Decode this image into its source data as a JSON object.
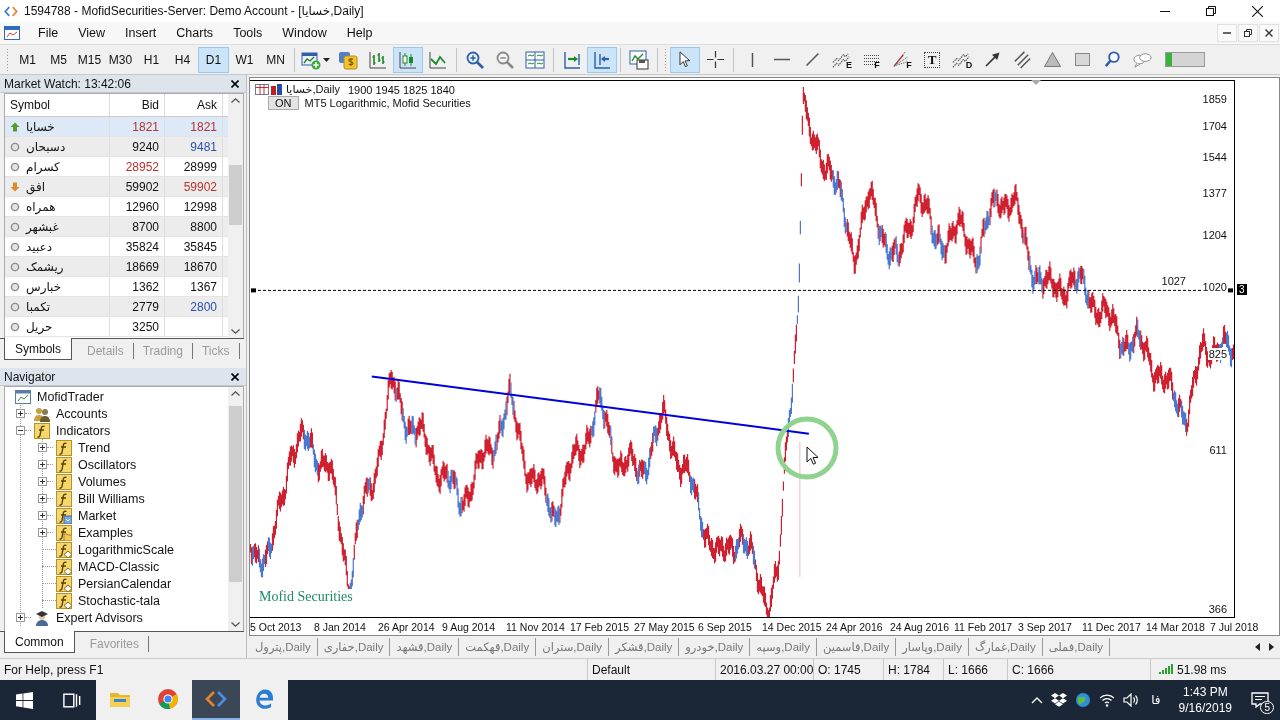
{
  "window": {
    "title": "1594788 - MofidSecurities-Server: Demo Account - [خسایا,Daily]"
  },
  "menu": [
    "File",
    "View",
    "Insert",
    "Charts",
    "Tools",
    "Window",
    "Help"
  ],
  "toolbar": {
    "timeframes": [
      {
        "label": "M1",
        "selected": false
      },
      {
        "label": "M5",
        "selected": false
      },
      {
        "label": "M15",
        "selected": false
      },
      {
        "label": "M30",
        "selected": false
      },
      {
        "label": "H1",
        "selected": false
      },
      {
        "label": "H4",
        "selected": false
      },
      {
        "label": "D1",
        "selected": true
      },
      {
        "label": "W1",
        "selected": false
      },
      {
        "label": "MN",
        "selected": false
      }
    ],
    "chart_tools": [
      {
        "kind": "new-chart",
        "selected": false
      },
      {
        "kind": "profiles",
        "selected": false
      },
      {
        "kind": "bar-chart",
        "selected": false
      },
      {
        "kind": "candles",
        "selected": true
      },
      {
        "kind": "line-chart",
        "selected": false
      },
      {
        "kind": "zoom-in",
        "selected": false
      },
      {
        "kind": "zoom-out",
        "selected": false
      },
      {
        "kind": "tile",
        "selected": false
      },
      {
        "kind": "autoscroll",
        "selected": false
      },
      {
        "kind": "chart-shift",
        "selected": true
      },
      {
        "kind": "templates",
        "selected": false
      }
    ],
    "drawing_tools": [
      {
        "kind": "cursor",
        "selected": true
      },
      {
        "kind": "crosshair",
        "selected": false
      },
      {
        "kind": "vertical-line",
        "selected": false
      },
      {
        "kind": "horizontal-line",
        "selected": false
      },
      {
        "kind": "trend-line",
        "selected": false
      },
      {
        "kind": "waves",
        "letter": "E",
        "selected": false
      },
      {
        "kind": "levels",
        "letter": "F",
        "selected": false
      },
      {
        "kind": "fan",
        "letter": "F",
        "selected": false
      },
      {
        "kind": "text",
        "letter": "T",
        "selected": false
      },
      {
        "kind": "waves",
        "letter": "D",
        "selected": false
      },
      {
        "kind": "arrow",
        "selected": false
      },
      {
        "kind": "channel",
        "selected": false
      },
      {
        "kind": "triangle",
        "selected": false
      },
      {
        "kind": "rectangle",
        "selected": false
      },
      {
        "kind": "search",
        "selected": false
      },
      {
        "kind": "chat",
        "selected": false
      }
    ],
    "meter": {
      "level": 0.15
    }
  },
  "market_watch": {
    "title": "Market Watch: 13:42:06",
    "columns": [
      "Symbol",
      "Bid",
      "Ask"
    ],
    "rows": [
      {
        "symbol": "خسایا",
        "kind": "up",
        "bid": {
          "text": "1821",
          "color": "#b8332b"
        },
        "ask": {
          "text": "1821",
          "color": "#b8332b"
        },
        "selected": true
      },
      {
        "symbol": "دسبحان",
        "kind": "flat",
        "bid": {
          "text": "9240",
          "color": "#111111"
        },
        "ask": {
          "text": "9481",
          "color": "#2a4fb0"
        },
        "selected": false
      },
      {
        "symbol": "کسرام",
        "kind": "flat",
        "bid": {
          "text": "28952",
          "color": "#b8332b"
        },
        "ask": {
          "text": "28999",
          "color": "#111111"
        },
        "selected": false
      },
      {
        "symbol": "افق",
        "kind": "down",
        "bid": {
          "text": "59902",
          "color": "#111111"
        },
        "ask": {
          "text": "59902",
          "color": "#b8332b"
        },
        "selected": false
      },
      {
        "symbol": "همراه",
        "kind": "flat",
        "bid": {
          "text": "12960",
          "color": "#111111"
        },
        "ask": {
          "text": "12998",
          "color": "#111111"
        },
        "selected": false
      },
      {
        "symbol": "غبشهر",
        "kind": "flat",
        "bid": {
          "text": "8700",
          "color": "#111111"
        },
        "ask": {
          "text": "8800",
          "color": "#111111"
        },
        "selected": false
      },
      {
        "symbol": "دعبید",
        "kind": "flat",
        "bid": {
          "text": "35824",
          "color": "#111111"
        },
        "ask": {
          "text": "35845",
          "color": "#111111"
        },
        "selected": false
      },
      {
        "symbol": "ریشمک",
        "kind": "flat",
        "bid": {
          "text": "18669",
          "color": "#111111"
        },
        "ask": {
          "text": "18670",
          "color": "#111111"
        },
        "selected": false
      },
      {
        "symbol": "خبارس",
        "kind": "flat",
        "bid": {
          "text": "1362",
          "color": "#111111"
        },
        "ask": {
          "text": "1367",
          "color": "#111111"
        },
        "selected": false
      },
      {
        "symbol": "تکمبا",
        "kind": "flat",
        "bid": {
          "text": "2779",
          "color": "#111111"
        },
        "ask": {
          "text": "2800",
          "color": "#2a4fb0"
        },
        "selected": false
      },
      {
        "symbol": "حریل",
        "kind": "flat",
        "bid": {
          "text": "3250",
          "color": "#111111"
        },
        "selected": false
      }
    ],
    "tabs": [
      {
        "label": "Symbols",
        "selected": true
      },
      {
        "label": "Details",
        "selected": false
      },
      {
        "label": "Trading",
        "selected": false
      },
      {
        "label": "Ticks",
        "selected": false
      }
    ]
  },
  "navigator": {
    "title": "Navigator",
    "tree": [
      {
        "label": "MofidTrader",
        "kind": "terminal",
        "children": [
          {
            "label": "Accounts",
            "kind": "accounts",
            "expanded": false
          },
          {
            "label": "Indicators",
            "kind": "function-folder",
            "expanded": true,
            "children": [
              {
                "label": "Trend",
                "kind": "function-folder",
                "expanded": false
              },
              {
                "label": "Oscillators",
                "kind": "function-folder",
                "expanded": false
              },
              {
                "label": "Volumes",
                "kind": "function-folder",
                "expanded": false
              },
              {
                "label": "Bill Williams",
                "kind": "function-folder",
                "expanded": false
              },
              {
                "label": "Market",
                "kind": "market-folder",
                "expanded": false
              },
              {
                "label": "Examples",
                "kind": "examples-folder",
                "expanded": false
              },
              {
                "label": "LogarithmicScale",
                "kind": "indicator"
              },
              {
                "label": "MACD-Classic",
                "kind": "indicator"
              },
              {
                "label": "PersianCalendar",
                "kind": "indicator"
              },
              {
                "label": "Stochastic-tala",
                "kind": "indicator"
              }
            ]
          },
          {
            "label": "Expert Advisors",
            "kind": "experts",
            "expanded": false
          }
        ]
      }
    ],
    "tabs": [
      {
        "label": "Common",
        "selected": true
      },
      {
        "label": "Favorites",
        "selected": false
      }
    ]
  },
  "chart": {
    "symbol": "خسایا,Daily",
    "prices": "1900 1945 1825 1840",
    "indicator_toggle": "ON",
    "indicator_label": "MT5 Logarithmic, Mofid Securities",
    "brand_label": "Mofid Securities",
    "price_labels": [
      "1859",
      "1704",
      "1544",
      "1377",
      "1204",
      "1020",
      "825",
      "611",
      "366"
    ],
    "date_labels": [
      "5 Oct 2013",
      "8 Jan 2014",
      "26 Apr 2014",
      "9 Aug 2014",
      "11 Nov 2014",
      "17 Feb 2015",
      "27 May 2015",
      "6 Sep 2015",
      "14 Dec 2015",
      "24 Apr 2016",
      "24 Aug 2016",
      "11 Feb 2017",
      "3 Sep 2017",
      "11 Dec 2017",
      "14 Mar 2018",
      "7 Jul 2018"
    ],
    "level_line": {
      "label": "1027",
      "tag": "3"
    }
  },
  "chart_tabs": [
    {
      "label": "پترول,Daily",
      "selected": false
    },
    {
      "label": "حفاری,Daily",
      "selected": false
    },
    {
      "label": "قشهد,Daily",
      "selected": false
    },
    {
      "label": "قهکمت,Daily",
      "selected": false
    },
    {
      "label": "ستران,Daily",
      "selected": false
    },
    {
      "label": "قشکر,Daily",
      "selected": false
    },
    {
      "label": "خودرو,Daily",
      "selected": false
    },
    {
      "label": "وسپه,Daily",
      "selected": false
    },
    {
      "label": "فاسمین,Daily",
      "selected": false
    },
    {
      "label": "وپاسار,Daily",
      "selected": false
    },
    {
      "label": "غمارگ,Daily",
      "selected": false
    },
    {
      "label": "فملی,Daily",
      "selected": false
    }
  ],
  "status_bar": {
    "help": "For Help, press F1",
    "profile": "Default",
    "time": "2016.03.27 00:00",
    "open": "O: 1745",
    "high": "H: 1784",
    "low": "L: 1666",
    "close": "C: 1666",
    "ping": "51.98 ms"
  },
  "taskbar": {
    "apps": [
      {
        "kind": "files",
        "selected": false
      },
      {
        "kind": "browser",
        "selected": false
      },
      {
        "kind": "terminal",
        "selected": true
      },
      {
        "kind": "edge",
        "selected": false
      }
    ],
    "language": "فا",
    "time": "1:43 PM",
    "date": "9/16/2019",
    "notifications": "5"
  }
}
